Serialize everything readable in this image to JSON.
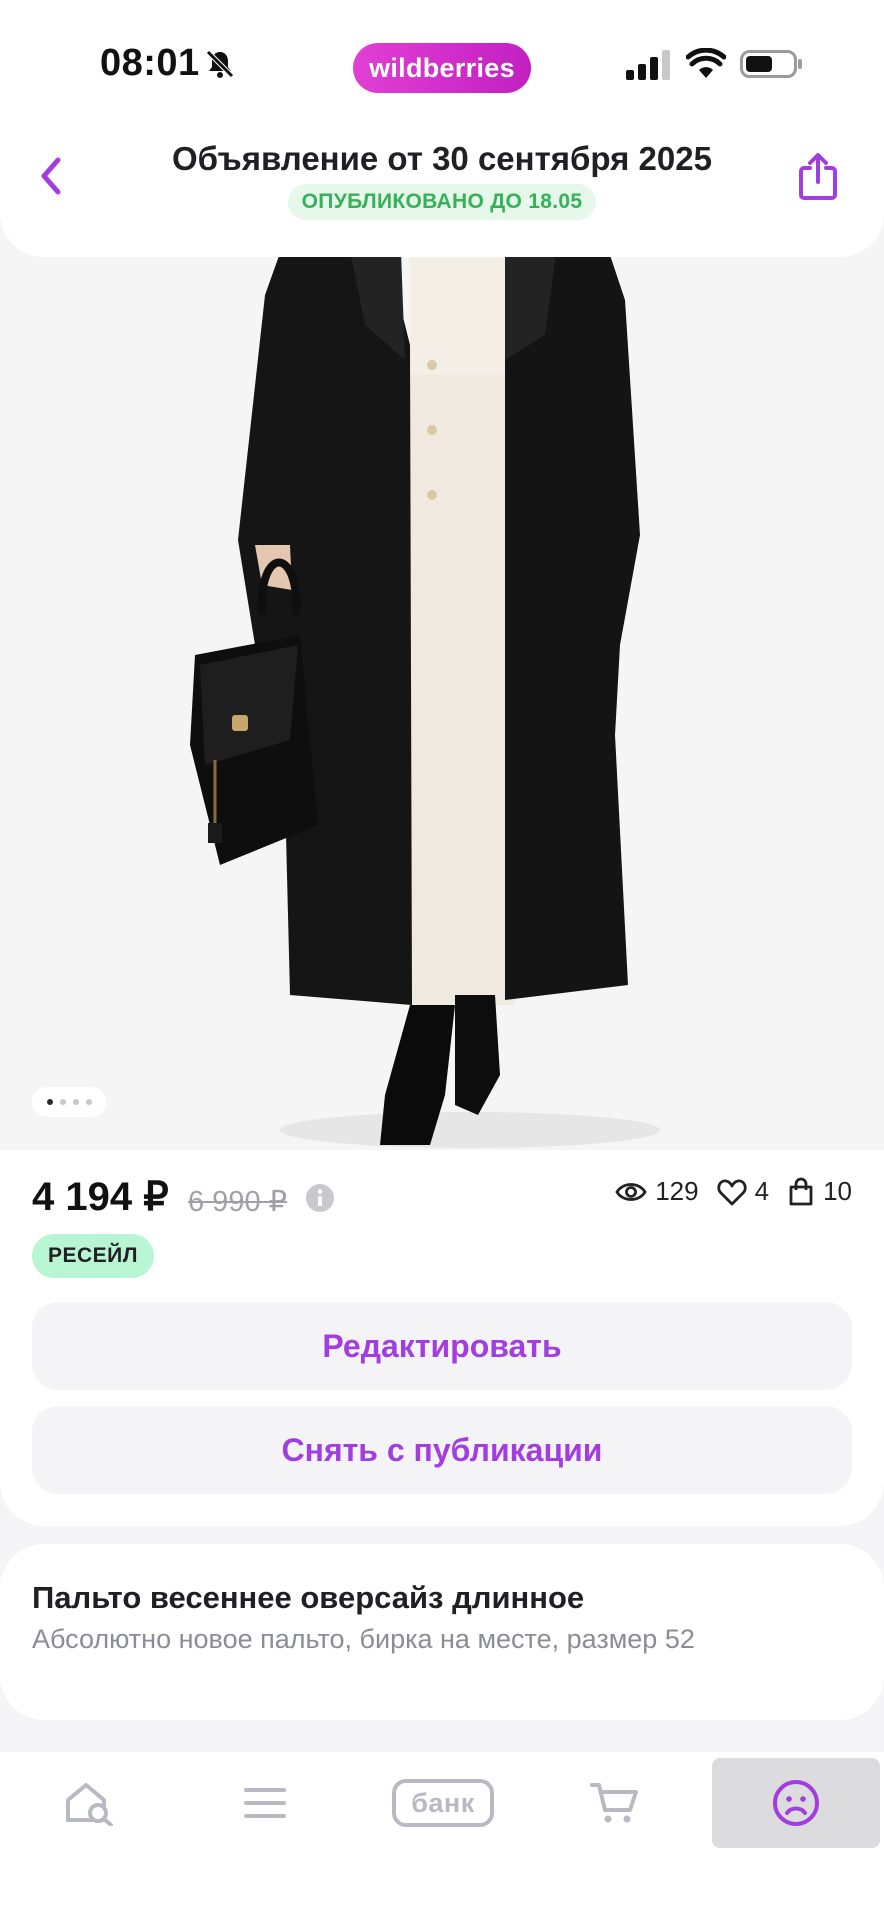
{
  "status_bar": {
    "time": "08:01",
    "brand": "wildberries",
    "icons": [
      "bell-muted-icon",
      "signal-icon",
      "wifi-icon",
      "battery-icon"
    ]
  },
  "header": {
    "title": "Объявление от 30 сентября 2025",
    "badge": "ОПУБЛИКОВАНО ДО 18.05",
    "back_icon": "chevron-left-icon",
    "share_icon": "share-icon"
  },
  "gallery": {
    "image": "product-photo-black-coat",
    "pages": 4,
    "current": 1
  },
  "product": {
    "price": "4 194 ₽",
    "old_price": "6 990 ₽",
    "views": "129",
    "likes": "4",
    "in_carts": "10",
    "tag": "РЕСЕЙЛ"
  },
  "actions": {
    "edit_label": "Редактировать",
    "unpublish_label": "Снять с публикации"
  },
  "description": {
    "title": "Пальто весеннее оверсайз длинное",
    "text": "Абсолютно новое пальто, бирка на месте, размер 52"
  },
  "nav": {
    "bank_label": "банк",
    "items": [
      "home-search-icon",
      "menu-icon",
      "bank-icon",
      "cart-icon",
      "profile-icon"
    ],
    "active": "profile"
  },
  "colors": {
    "accent": "#a23ee0",
    "brand": "#cb2bc9",
    "success": "#36b15a",
    "resale_bg": "#b8f5d3"
  }
}
